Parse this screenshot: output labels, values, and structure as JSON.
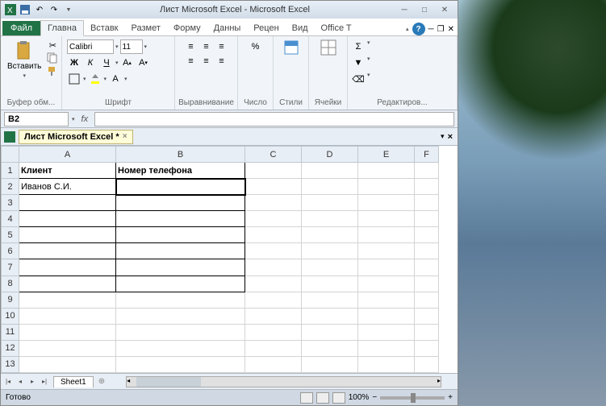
{
  "titlebar": {
    "title": "Лист Microsoft Excel - Microsoft Excel"
  },
  "tabs": {
    "file": "Файл",
    "items": [
      "Главна",
      "Вставк",
      "Размет",
      "Форму",
      "Данны",
      "Рецен",
      "Вид",
      "Office T"
    ]
  },
  "ribbon": {
    "clipboard": {
      "paste": "Вставить",
      "label": "Буфер обм..."
    },
    "font": {
      "name": "Calibri",
      "size": "11",
      "label": "Шрифт"
    },
    "align": {
      "label": "Выравнивание"
    },
    "number": {
      "label": "Число"
    },
    "styles": {
      "label": "Стили"
    },
    "cells": {
      "label": "Ячейки"
    },
    "editing": {
      "label": "Редактиров..."
    }
  },
  "namebox": "B2",
  "doc_tab": "Лист Microsoft Excel *",
  "columns": [
    "A",
    "B",
    "C",
    "D",
    "E",
    "F"
  ],
  "rows": [
    "1",
    "2",
    "3",
    "4",
    "5",
    "6",
    "7",
    "8",
    "9",
    "10",
    "11",
    "12",
    "13"
  ],
  "cells": {
    "A1": "Клиент",
    "B1": "Номер телефона",
    "A2": "Иванов С.И."
  },
  "sheet": {
    "name": "Sheet1"
  },
  "status": {
    "ready": "Готово",
    "zoom": "100%"
  }
}
